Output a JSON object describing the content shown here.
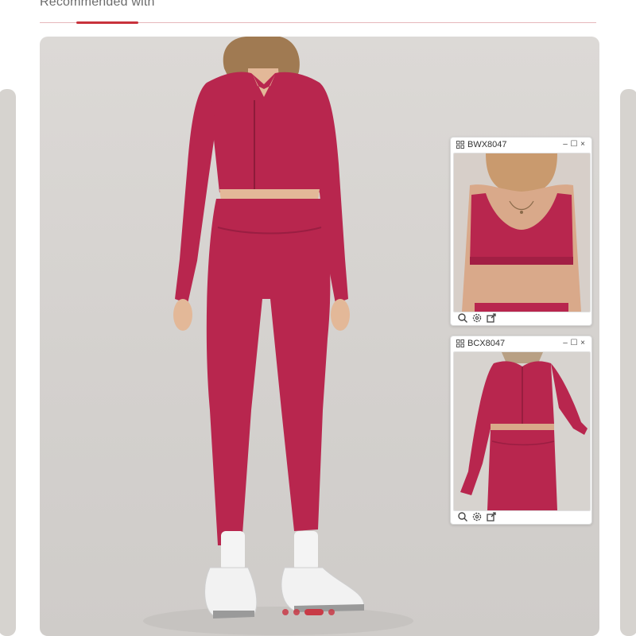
{
  "section": {
    "title": "Recommended with"
  },
  "colors": {
    "accent": "#c8323c",
    "garment": "#b8264e",
    "background": "#d8d5d2"
  },
  "main_image": {
    "description_icon": "product-photo",
    "carousel": {
      "total": 4,
      "active_index": 2
    }
  },
  "popups": [
    {
      "code": "BWX8047",
      "icons": [
        "grid-icon",
        "minimize-icon",
        "maximize-icon",
        "close-icon"
      ],
      "tools": [
        "zoom-icon",
        "settings-icon",
        "share-icon"
      ]
    },
    {
      "code": "BCX8047",
      "icons": [
        "grid-icon",
        "minimize-icon",
        "maximize-icon",
        "close-icon"
      ],
      "tools": [
        "zoom-icon",
        "settings-icon",
        "share-icon"
      ]
    }
  ],
  "window_buttons": {
    "minimize": "–",
    "maximize": "☐",
    "close": "×"
  }
}
